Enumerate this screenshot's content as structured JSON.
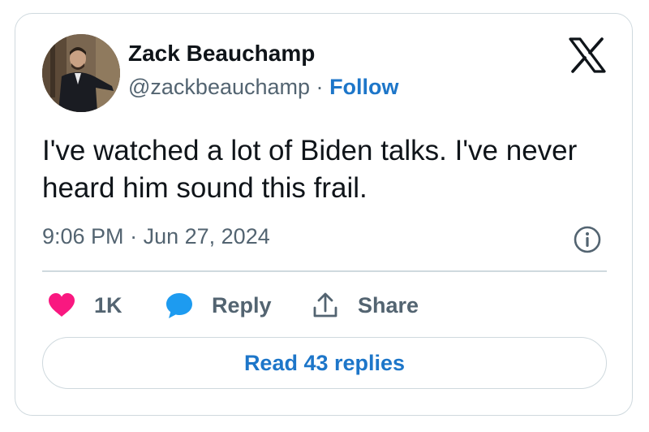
{
  "author": {
    "name": "Zack Beauchamp",
    "handle": "@zackbeauchamp",
    "separator": "·",
    "follow_label": "Follow"
  },
  "tweet": {
    "text": "I've watched a lot of Biden talks. I've never heard him sound this frail.",
    "time": "9:06 PM",
    "date_separator": "·",
    "date": "Jun 27, 2024"
  },
  "actions": {
    "like_count": "1K",
    "reply_label": "Reply",
    "share_label": "Share"
  },
  "read_replies_label": "Read 43 replies",
  "icons": {
    "platform": "x-logo-icon",
    "info": "info-icon",
    "like": "heart-icon",
    "reply": "speech-bubble-icon",
    "share": "share-icon"
  },
  "colors": {
    "link": "#1d76c9",
    "like": "#f91880",
    "reply": "#1d9bf0",
    "text": "#0f1419",
    "secondary_text": "#536471",
    "border": "#cfd9de"
  }
}
